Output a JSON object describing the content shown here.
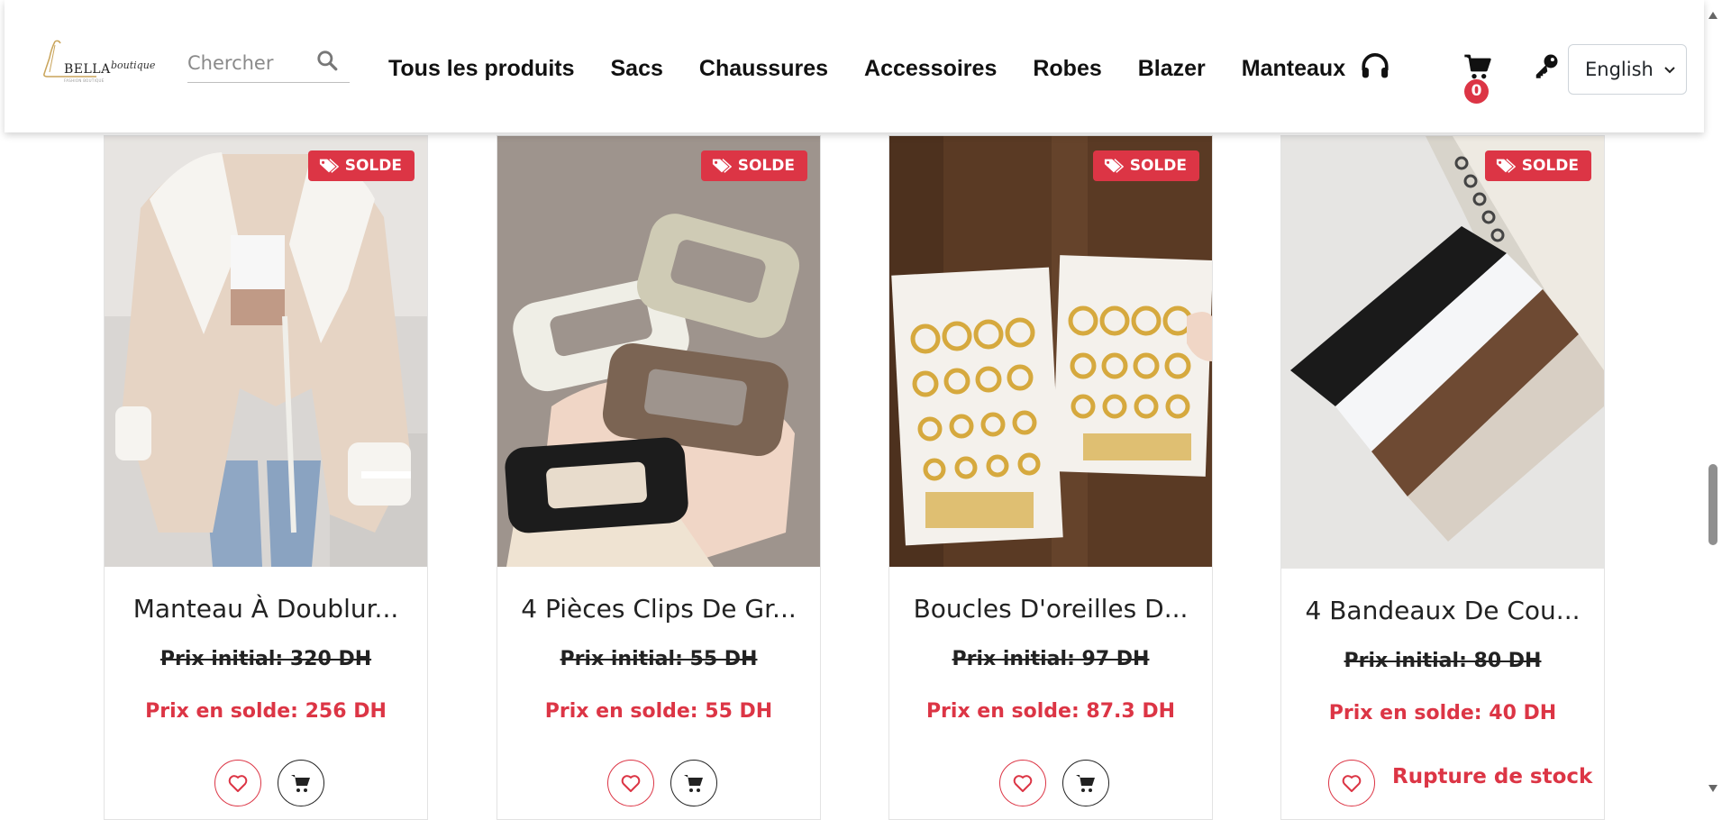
{
  "header": {
    "logo_brand": "BELLA",
    "logo_script": "boutique",
    "logo_tagline": "FASHION BOUTIQUE",
    "search_placeholder": "Chercher",
    "nav": [
      "Tous les produits",
      "Sacs",
      "Chaussures",
      "Accessoires",
      "Robes",
      "Blazer",
      "Manteaux"
    ],
    "cart_count": "0",
    "language": "English"
  },
  "icons": {
    "search": "search-icon",
    "support": "headset-icon",
    "cart": "cart-icon",
    "login": "key-icon",
    "favorite": "heart-icon",
    "sale_tag": "tag-icon"
  },
  "colors": {
    "accent": "#dc3545",
    "text": "#212529"
  },
  "products": [
    {
      "badge": "SOLDE",
      "title": "Manteau À Doublur...",
      "old_price": "Prix initial: 320 DH",
      "sale_price": "Prix en solde: 256 DH",
      "in_stock": true
    },
    {
      "badge": "SOLDE",
      "title": "4 Pièces Clips De Gr...",
      "old_price": "Prix initial: 55 DH",
      "sale_price": "Prix en solde: 55 DH",
      "in_stock": true
    },
    {
      "badge": "SOLDE",
      "title": "Boucles D'oreilles D...",
      "old_price": "Prix initial: 97 DH",
      "sale_price": "Prix en solde: 87.3 DH",
      "in_stock": true
    },
    {
      "badge": "SOLDE",
      "title": "4 Bandeaux De Cou...",
      "old_price": "Prix initial: 80 DH",
      "sale_price": "Prix en solde: 40 DH",
      "in_stock": false,
      "stock_label": "Rupture de stock"
    }
  ]
}
